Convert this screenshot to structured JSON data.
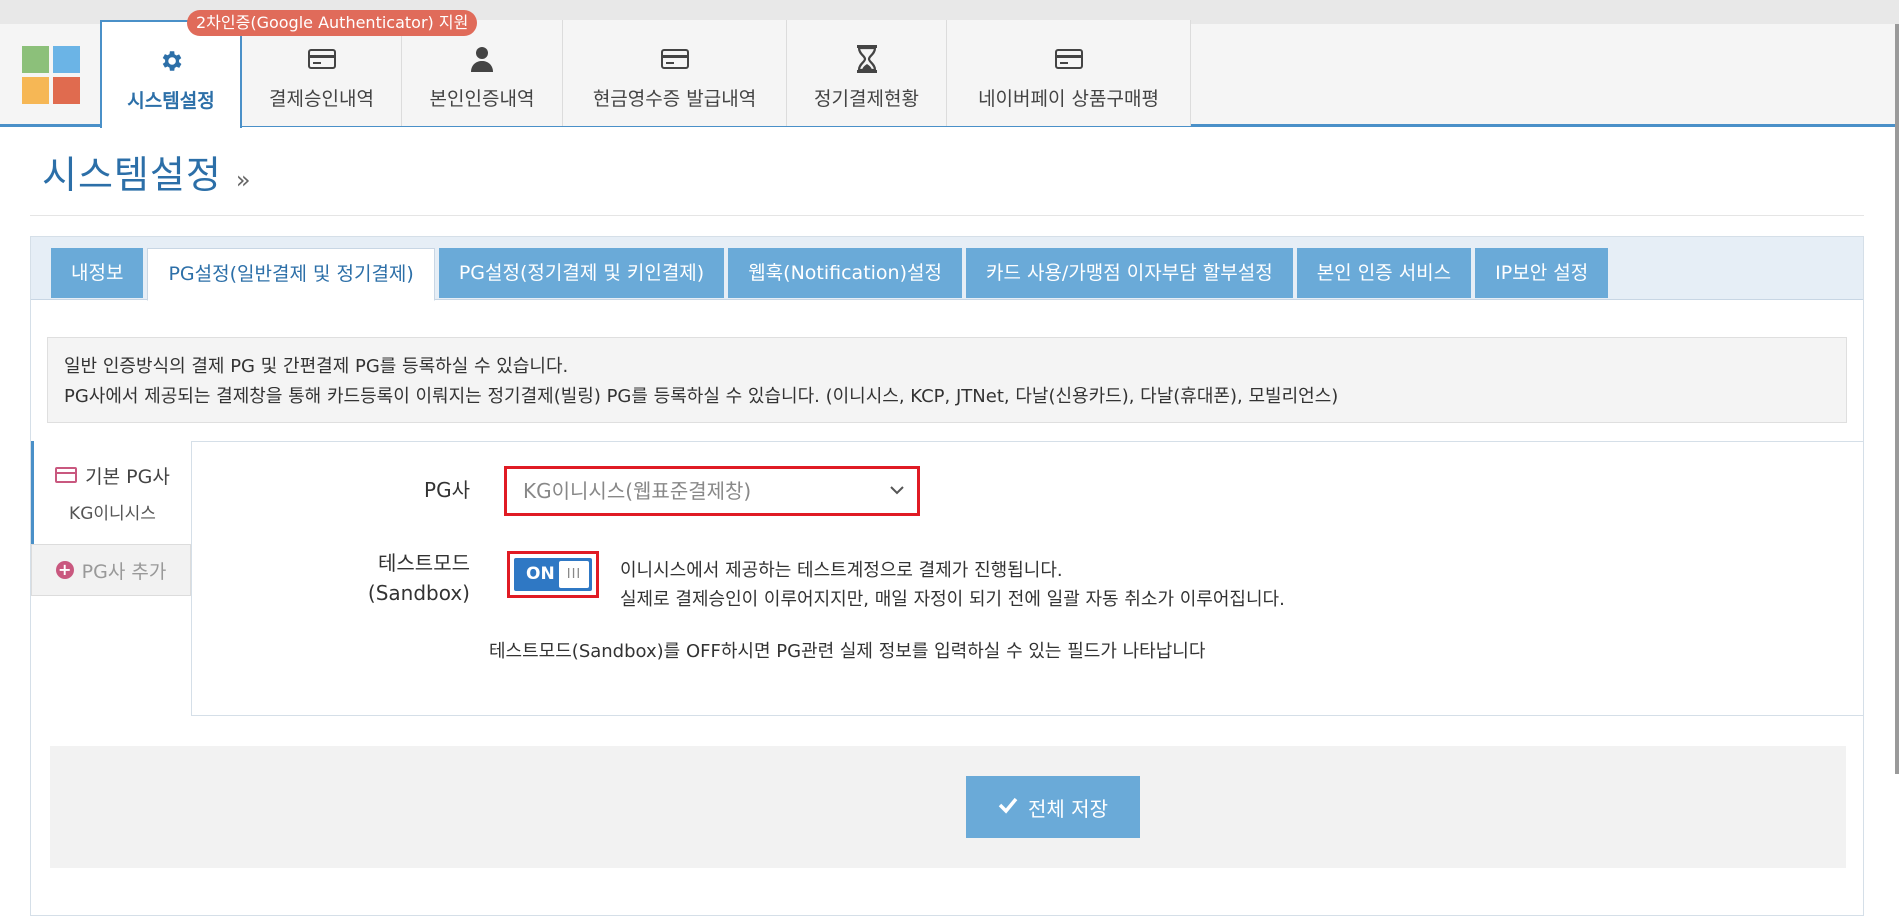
{
  "badge": "2차인증(Google Authenticator) 지원",
  "nav": [
    {
      "label": "시스템설정",
      "icon": "gear-icon"
    },
    {
      "label": "결제승인내역",
      "icon": "credit-card-icon"
    },
    {
      "label": "본인인증내역",
      "icon": "user-icon"
    },
    {
      "label": "현금영수증 발급내역",
      "icon": "credit-card-icon"
    },
    {
      "label": "정기결제현황",
      "icon": "hourglass-icon"
    },
    {
      "label": "네이버페이 상품구매평",
      "icon": "credit-card-icon"
    }
  ],
  "page": {
    "title": "시스템설정",
    "title_suffix": "»"
  },
  "tabs": [
    "내정보",
    "PG설정(일반결제 및 정기결제)",
    "PG설정(정기결제 및 키인결제)",
    "웹훅(Notification)설정",
    "카드 사용/가맹점 이자부담 할부설정",
    "본인 인증 서비스",
    "IP보안 설정"
  ],
  "info": {
    "line1": "일반 인증방식의 결제 PG 및 간편결제 PG를 등록하실 수 있습니다.",
    "line2": "PG사에서 제공되는 결제창을 통해 카드등록이 이뤄지는 정기결제(빌링) PG를 등록하실 수 있습니다. (이니시스, KCP, JTNet, 다날(신용카드), 다날(휴대폰), 모빌리언스)"
  },
  "sidebar": {
    "default_pg_label": "기본 PG사",
    "default_pg_value": "KG이니시스",
    "add_pg_label": "PG사 추가"
  },
  "form": {
    "pg_label": "PG사",
    "pg_selected": "KG이니시스(웹표준결제창)",
    "test_label_1": "테스트모드",
    "test_label_2": "(Sandbox)",
    "toggle_on": "ON",
    "toggle_grip": "III",
    "test_desc_1": "이니시스에서 제공하는 테스트계정으로 결제가 진행됩니다.",
    "test_desc_2": "실제로 결제승인이 이루어지지만, 매일 자정이 되기 전에 일괄 자동 취소가 이루어집니다.",
    "test_hint": "테스트모드(Sandbox)를 OFF하시면 PG관련 실제 정보를 입력하실 수 있는 필드가 나타납니다"
  },
  "save_button": "전체 저장",
  "colors": {
    "accent": "#4a90c8",
    "tab_bg": "#6aaad8",
    "highlight": "#e01b24",
    "toggle": "#2f78c4"
  }
}
